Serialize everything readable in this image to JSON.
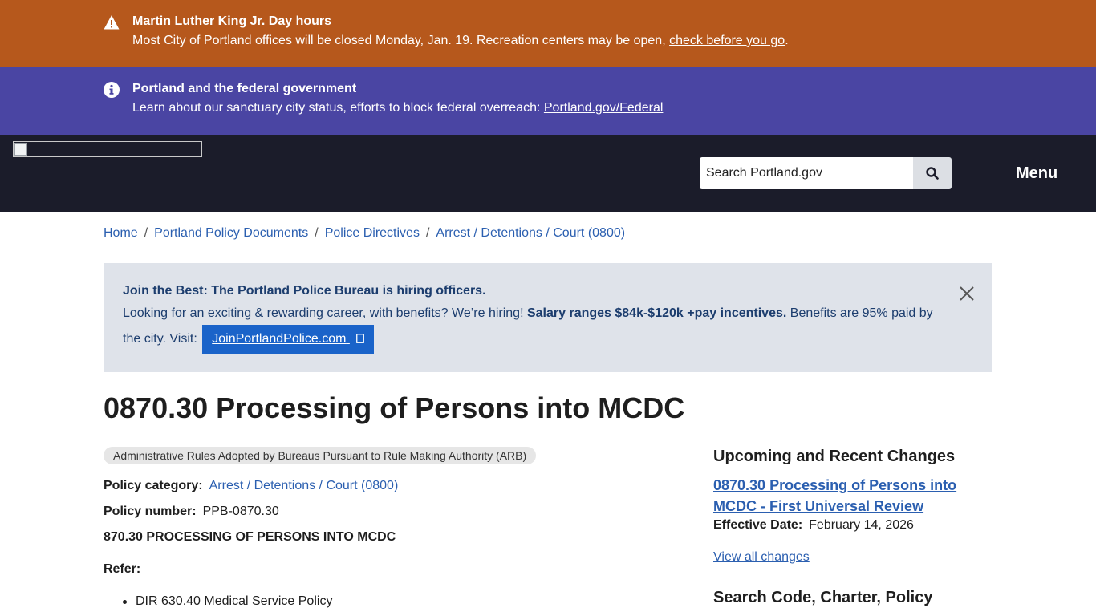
{
  "alerts": {
    "holiday": {
      "title": "Martin Luther King Jr. Day hours",
      "text": "Most City of Portland offices will be closed Monday, Jan. 19. Recreation centers may be open,",
      "link": "check before you go",
      "after_link": ".",
      "icon": "warning-triangle-icon",
      "color": "#b6581c"
    },
    "federal": {
      "title": "Portland and the federal government",
      "text": "Learn about our sanctuary city status, efforts to block federal overreach:",
      "link": "Portland.gov/Federal",
      "icon": "info-circle-icon",
      "color": "#4a45a3"
    }
  },
  "header": {
    "search_placeholder": "Search Portland.gov",
    "menu_label": "Menu",
    "background": "#1b1c2a"
  },
  "breadcrumb": {
    "items": [
      "Home",
      "Portland Policy Documents",
      "Police Directives",
      "Arrest / Detentions / Court (0800)"
    ],
    "separator": "/"
  },
  "promo": {
    "title": "Join the Best: The Portland Police Bureau is hiring officers.",
    "text_start": "Looking for an exciting & rewarding career, with benefits? We’re hiring!",
    "text_bold": "Salary ranges $84k-$120k +pay incentives.",
    "text_end": "Benefits are 95% paid by the city. Visit:",
    "button_label": "JoinPortlandPolice.com",
    "button_icon": "external-link-icon",
    "background": "#dfe3ea",
    "button_color": "#1a63c9"
  },
  "main": {
    "title": "0870.30 Processing of Persons into MCDC",
    "tag": "Administrative Rules Adopted by Bureaus Pursuant to Rule Making Authority (ARB)",
    "policy_category_label": "Policy category:",
    "policy_category_value": "Arrest / Detentions / Court (0800)",
    "policy_number_label": "Policy number:",
    "policy_number_value": "PPB-0870.30",
    "section_heading": "870.30 PROCESSING OF PERSONS INTO MCDC",
    "refer_label": "Refer:",
    "refer_items": [
      "DIR 630.40 Medical Service Policy"
    ]
  },
  "sidebar": {
    "changes_heading": "Upcoming and Recent Changes",
    "change_link": "0870.30 Processing of Persons into MCDC - First Universal Review",
    "effective_label": "Effective Date:",
    "effective_value": "February 14, 2026",
    "view_all": "View all changes",
    "search_heading": "Search Code, Charter, Policy"
  }
}
